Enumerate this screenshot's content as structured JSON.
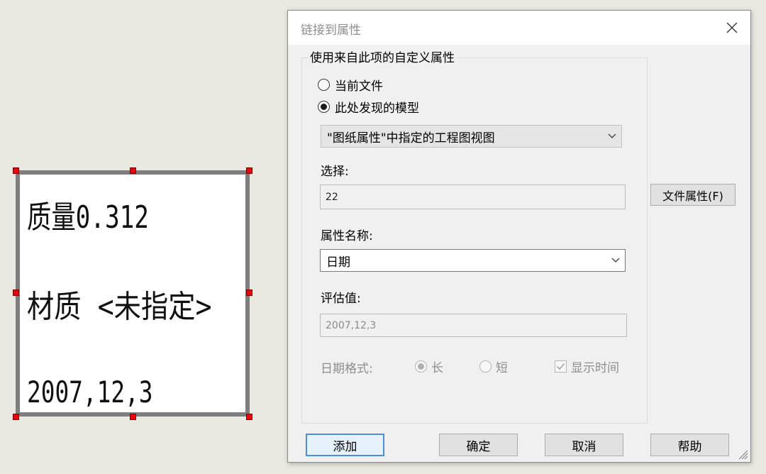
{
  "drawing": {
    "note_lines": [
      "质量0.312",
      "材质 <未指定>",
      "2007,12,3"
    ],
    "handle_color": "#e8070e"
  },
  "dialog": {
    "title": "链接到属性",
    "group_title": "使用来自此项的自定义属性",
    "source_options": [
      {
        "label": "当前文件",
        "selected": false
      },
      {
        "label": "此处发现的模型",
        "selected": true
      }
    ],
    "model_source_select": {
      "value": "\"图纸属性\"中指定的工程图视图"
    },
    "selection": {
      "label": "选择:",
      "value": "22"
    },
    "file_properties_button": "文件属性(F)",
    "property_name": {
      "label": "属性名称:",
      "value": "日期"
    },
    "evaluated_value": {
      "label": "评估值:",
      "value": "2007,12,3"
    },
    "date_format": {
      "label": "日期格式:",
      "long_label": "长",
      "short_label": "短",
      "long_selected": true,
      "show_time_label": "显示时间",
      "show_time_checked": true
    },
    "buttons": {
      "add": "添加",
      "ok": "确定",
      "cancel": "取消",
      "help": "帮助"
    },
    "accent_color": "#4c8ed8"
  }
}
